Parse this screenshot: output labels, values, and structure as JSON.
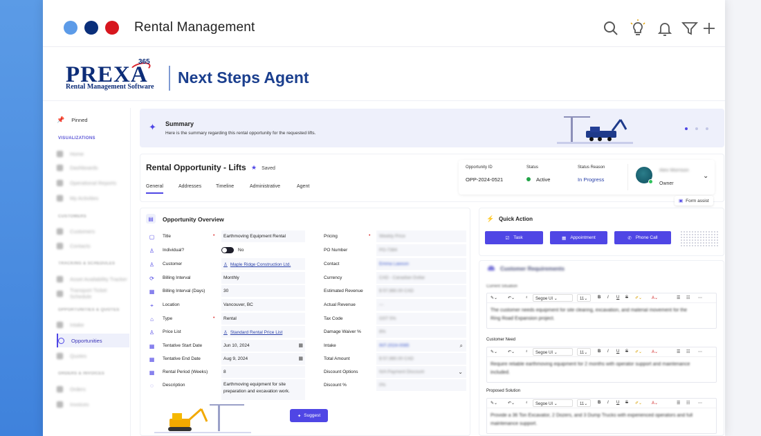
{
  "window": {
    "title": "Rental Management",
    "traffic_lights": [
      "#5c9be8",
      "#0a2f7a",
      "#d7161e"
    ],
    "toolbar_icons": [
      "search-icon",
      "lightbulb-icon",
      "bell-icon",
      "filter-icon",
      "plus-icon"
    ]
  },
  "brand": {
    "logo_name": "PREXA",
    "logo_badge": "365",
    "logo_tagline": "Rental Management Software",
    "agent_title": "Next Steps Agent"
  },
  "sidebar": {
    "pinned": "Pinned",
    "visualizations": "VISUALIZATIONS",
    "vis_items": [
      "Home",
      "Dashboards",
      "Operational Reports",
      "My Activities"
    ],
    "customers_section": "CUSTOMERS",
    "customer_items": [
      "Customers",
      "Contacts"
    ],
    "tracking_section": "TRACKING & SCHEDULES",
    "tracking_items": [
      "Asset Availability Tracker",
      "Transport Ticket Schedule"
    ],
    "opps_section": "OPPORTUNITIES & QUOTES",
    "opps_items": [
      "Intake",
      "Opportunities",
      "Quotes"
    ],
    "orders_section": "ORDERS & INVOICES",
    "orders_items": [
      "Orders",
      "Invoices"
    ]
  },
  "summary": {
    "title": "Summary",
    "text": "Here is the summary regarding this rental opportunity for the requested lifts."
  },
  "opportunity": {
    "title": "Rental Opportunity - Lifts",
    "saved": "Saved",
    "tabs": [
      "General",
      "Addresses",
      "Timeline",
      "Administrative",
      "Agent"
    ],
    "id_label": "Opportunity ID",
    "id_value": "OPP-2024-0521",
    "status_label": "Status",
    "status_value": "Active",
    "reason_label": "Status Reason",
    "reason_value": "In Progress",
    "owner_name": "Alex Morrison",
    "owner_label": "Owner",
    "form_assist": "Form assist"
  },
  "overview": {
    "title": "Opportunity Overview",
    "left_fields": [
      {
        "label": "Title",
        "value": "Earthmoving Equipment Rental"
      },
      {
        "label": "Individual?",
        "value": "No"
      },
      {
        "label": "Customer",
        "value": "Maple Ridge Construction Ltd."
      },
      {
        "label": "Billing Interval",
        "value": "Monthly"
      },
      {
        "label": "Billing Interval (Days)",
        "value": "30"
      },
      {
        "label": "Location",
        "value": "Vancouver, BC"
      },
      {
        "label": "Type",
        "value": "Rental"
      },
      {
        "label": "Price List",
        "value": "Standard Rental Price List"
      },
      {
        "label": "Tentative Start Date",
        "value": "Jun 10, 2024"
      },
      {
        "label": "Tentative End Date",
        "value": "Aug 9, 2024"
      },
      {
        "label": "Rental Period (Weeks)",
        "value": "8"
      },
      {
        "label": "Description",
        "value": "Earthmoving equipment for site preparation and excavation work."
      }
    ],
    "right_fields": [
      {
        "label": "Pricing",
        "value": "Weekly Price"
      },
      {
        "label": "PO Number",
        "value": "PO-7384"
      },
      {
        "label": "Contact",
        "value": "Emma Lawson"
      },
      {
        "label": "Currency",
        "value": "CAD - Canadian Dollar"
      },
      {
        "label": "Estimated Revenue",
        "value": "$ 57,980.00 CAD"
      },
      {
        "label": "Actual Revenue",
        "value": "---"
      },
      {
        "label": "Tax Code",
        "value": "GST 5%"
      },
      {
        "label": "Damage Waiver %",
        "value": "8%"
      },
      {
        "label": "Intake",
        "value": "INT-2024-0085"
      },
      {
        "label": "Total Amount",
        "value": "$ 57,980.00 CAD"
      },
      {
        "label": "Discount Options",
        "value": "N/A Payment Discount"
      },
      {
        "label": "Discount %",
        "value": "0%"
      }
    ],
    "suggest": "Suggest"
  },
  "quick_action": {
    "title": "Quick Action",
    "buttons": [
      "Task",
      "Appointment",
      "Phone Call"
    ]
  },
  "requirements": {
    "title": "Customer Requirements",
    "sections": [
      {
        "label": "Current Situation",
        "text": "The customer needs equipment for site clearing, excavation, and material movement for the Ring Road Expansion project."
      },
      {
        "label": "Customer Need",
        "text": "Require reliable earthmoving equipment for 2 months with operator support and maintenance included."
      },
      {
        "label": "Proposed Solution",
        "text": "Provide a 36 Ton Excavator, 2 Dozers, and 3 Dump Trucks with experienced operators and full maintenance support."
      }
    ],
    "toolbar": {
      "font": "Segoe UI",
      "size": "11",
      "bold": "B",
      "italic": "I",
      "underline": "U",
      "strike": "S"
    }
  },
  "colors": {
    "accent": "#4f46e5",
    "navy": "#1b3f8e",
    "active_green": "#22a447"
  }
}
